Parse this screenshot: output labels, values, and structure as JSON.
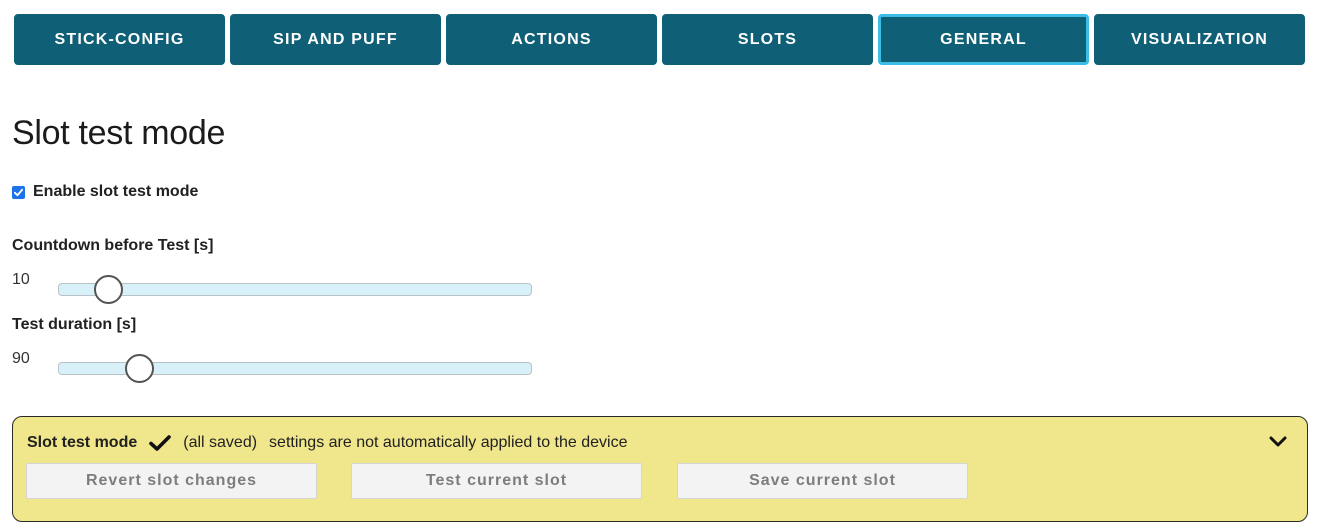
{
  "tabs": [
    {
      "label": "STICK-CONFIG",
      "active": false
    },
    {
      "label": "SIP AND PUFF",
      "active": false
    },
    {
      "label": "ACTIONS",
      "active": false
    },
    {
      "label": "SLOTS",
      "active": false
    },
    {
      "label": "GENERAL",
      "active": true
    },
    {
      "label": "VISUALIZATION",
      "active": false
    }
  ],
  "section": {
    "title": "Slot test mode",
    "enable_checkbox": {
      "label": "Enable slot test mode",
      "checked": true
    },
    "countdown": {
      "label": "Countdown before Test [s]",
      "value": "10",
      "slider_fraction": 0.08
    },
    "duration": {
      "label": "Test duration [s]",
      "value": "90",
      "slider_fraction": 0.15
    }
  },
  "panel": {
    "title": "Slot test mode",
    "status_icon": "checkmark-icon",
    "status": "(all saved)",
    "note": "settings are not automatically applied to the device",
    "toggle_icon": "chevron-down-icon",
    "buttons": {
      "revert": "Revert slot changes",
      "test": "Test current slot",
      "save": "Save current slot"
    }
  },
  "colors": {
    "tab_bg": "#0f5f76",
    "tab_active_border": "#3bbde6",
    "panel_bg": "#f0e68c",
    "slider_track": "#d8f1f8",
    "checkbox_accent": "#1a73e8"
  }
}
